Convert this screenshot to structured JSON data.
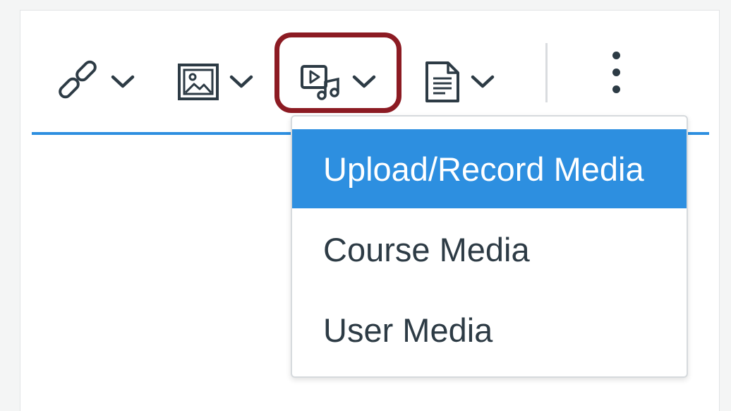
{
  "toolbar": {
    "tools": [
      {
        "name": "link",
        "icon": "link-icon"
      },
      {
        "name": "image",
        "icon": "image-icon"
      },
      {
        "name": "media",
        "icon": "media-icon",
        "highlighted": true
      },
      {
        "name": "document",
        "icon": "document-icon"
      }
    ],
    "more_icon": "more-vertical-icon",
    "accent_color": "#2d8fe0",
    "highlight_color": "#8c1b23"
  },
  "media_menu": {
    "items": [
      {
        "label": "Upload/Record Media",
        "active": true
      },
      {
        "label": "Course Media",
        "active": false
      },
      {
        "label": "User Media",
        "active": false
      }
    ],
    "active_bg": "#2d8fe0"
  }
}
